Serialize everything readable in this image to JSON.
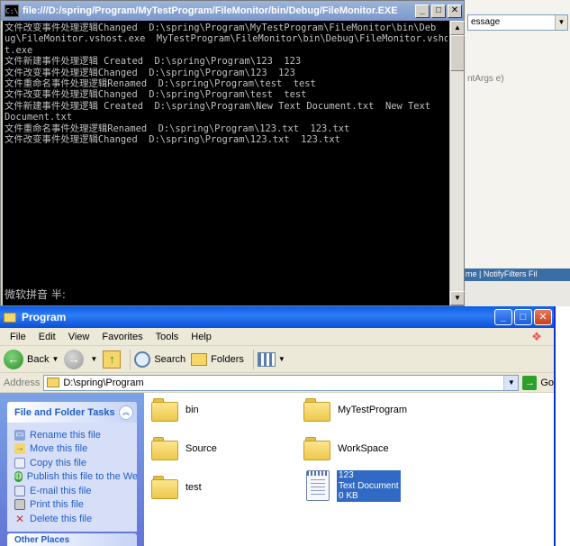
{
  "ide_background": {
    "combo_text": "essage",
    "code_text": "ntArgs e)",
    "bottom_bar_text": "me | NotifyFilters Fil"
  },
  "console": {
    "icon_text": "C:\\",
    "title": "file:///D:/spring/Program/MyTestProgram/FileMonitor/bin/Debug/FileMonitor.EXE",
    "lines": [
      "文件改变事件处理逻辑Changed  D:\\spring\\Program\\MyTestProgram\\FileMonitor\\bin\\Deb",
      "ug\\FileMonitor.vshost.exe  MyTestProgram\\FileMonitor\\bin\\Debug\\FileMonitor.vshos",
      "t.exe",
      "文件新建事件处理逻辑 Created  D:\\spring\\Program\\123  123",
      "文件改变事件处理逻辑Changed  D:\\spring\\Program\\123  123",
      "文件重命名事件处理逻辑Renamed  D:\\spring\\Program\\test  test",
      "文件改变事件处理逻辑Changed  D:\\spring\\Program\\test  test",
      "文件新建事件处理逻辑 Created  D:\\spring\\Program\\New Text Document.txt  New Text",
      "Document.txt",
      "文件重命名事件处理逻辑Renamed  D:\\spring\\Program\\123.txt  123.txt",
      "文件改变事件处理逻辑Changed  D:\\spring\\Program\\123.txt  123.txt"
    ],
    "ime_status": "微软拼音 半:",
    "min_glyph": "_",
    "max_glyph": "□",
    "close_glyph": "✕"
  },
  "explorer": {
    "title": "Program",
    "min_glyph": "_",
    "max_glyph": "□",
    "close_glyph": "✕",
    "menu": [
      "File",
      "Edit",
      "View",
      "Favorites",
      "Tools",
      "Help"
    ],
    "toolbar": {
      "back_label": "Back",
      "search_label": "Search",
      "folders_label": "Folders"
    },
    "address": {
      "label": "Address",
      "value": "D:\\spring\\Program",
      "go_label": "Go"
    },
    "tasks": {
      "header": "File and Folder Tasks",
      "items": [
        "Rename this file",
        "Move this file",
        "Copy this file",
        "Publish this file to the Web",
        "E-mail this file",
        "Print this file",
        "Delete this file"
      ],
      "other_header": "Other Places"
    },
    "files": [
      {
        "name": "bin",
        "kind": "folder"
      },
      {
        "name": "MyTestProgram",
        "kind": "folder"
      },
      {
        "name": "Source",
        "kind": "folder"
      },
      {
        "name": "WorkSpace",
        "kind": "folder"
      },
      {
        "name": "test",
        "kind": "folder"
      },
      {
        "name": "123",
        "kind": "text",
        "type_label": "Text Document",
        "size": "0 KB"
      }
    ]
  }
}
